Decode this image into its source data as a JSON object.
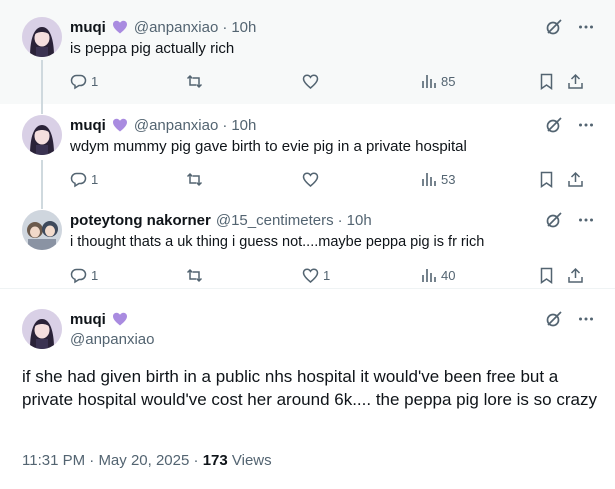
{
  "replies": [
    {
      "name": "muqi",
      "handle": "@anpanxiao",
      "dot": "·",
      "time": "10h",
      "text": "is peppa pig actually rich",
      "replies_count": "1",
      "likes_count": "",
      "views": "85"
    },
    {
      "name": "muqi",
      "handle": "@anpanxiao",
      "dot": "·",
      "time": "10h",
      "text": "wdym mummy pig gave birth to evie pig in a private hospital",
      "replies_count": "1",
      "likes_count": "",
      "views": "53"
    },
    {
      "name": "poteytong nakorner",
      "handle": "@15_centimeters",
      "dot": "·",
      "time": "10h",
      "text": "i thought thats a uk thing i guess not....maybe peppa pig is fr rich",
      "replies_count": "1",
      "likes_count": "1",
      "views": "40"
    }
  ],
  "main_post": {
    "name": "muqi",
    "handle": "@anpanxiao",
    "text": "if she had given birth in a public nhs hospital it would've been free but a private hospital would've cost her around 6k.... the peppa pig lore is so crazy",
    "time": "11:31 PM",
    "dot": "·",
    "date": "May 20, 2025",
    "dot2": "·",
    "views": "173",
    "views_label": "Views"
  },
  "colors": {
    "text": "#0f1419",
    "secondary": "#536471",
    "thread_line": "#cfd9de",
    "highlight_bg": "#f7f9f9",
    "badge": "#a98be0"
  },
  "icons": [
    "reply-icon",
    "retweet-icon",
    "like-icon",
    "views-icon",
    "bookmark-icon",
    "share-icon",
    "grok-icon",
    "more-icon",
    "purple-heart-icon"
  ]
}
